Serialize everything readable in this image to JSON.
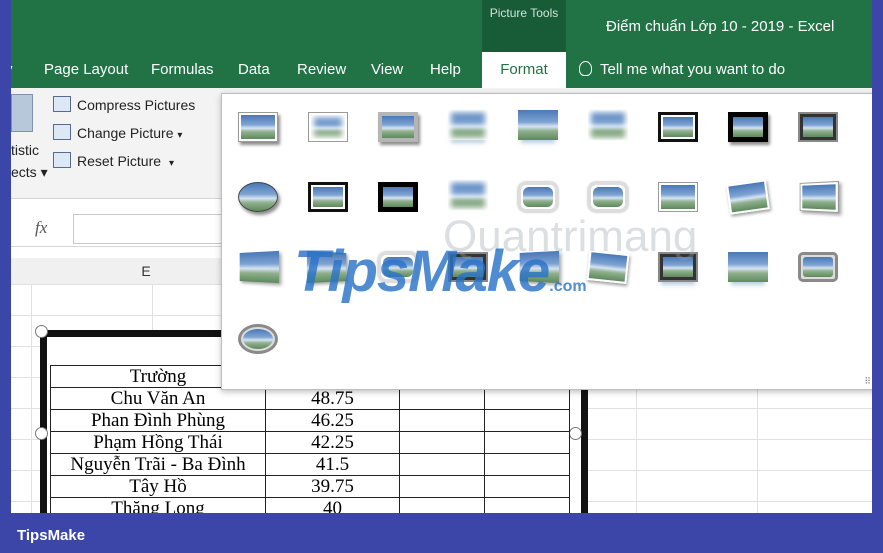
{
  "window": {
    "contextual_tab_group": "Picture Tools",
    "document_title": "Điểm chuẩn Lớp 10 - 2019  -  Excel"
  },
  "ribbon_tabs": [
    "v",
    "Page Layout",
    "Formulas",
    "Data",
    "Review",
    "View",
    "Help",
    "Format"
  ],
  "tell_me": "Tell me what you want to do",
  "adjust_group": {
    "left_partial_1": "tistic",
    "left_partial_2": "ects",
    "compress": "Compress Pictures",
    "change": "Change Picture",
    "reset": "Reset Picture"
  },
  "formula_bar": {
    "fx": "fx",
    "value": ""
  },
  "column_header": "E",
  "picture_table": {
    "header": "Trường",
    "rows": [
      {
        "school": "Chu Văn An",
        "score": "48.75"
      },
      {
        "school": "Phan Đình Phùng",
        "score": "46.25"
      },
      {
        "school": "Phạm Hồng Thái",
        "score": "42.25"
      },
      {
        "school": "Nguyễn Trãi - Ba Đình",
        "score": "41.5"
      },
      {
        "school": "Tây Hồ",
        "score": "39.75"
      },
      {
        "school": "Thăng Long",
        "score": "40"
      }
    ]
  },
  "picture_styles": [
    "simple-frame-white",
    "soft-edge-rectangle",
    "simple-frame-gray",
    "reflected-soft-edge",
    "soft-edge-reflection",
    "soft-edge",
    "double-frame-black",
    "thick-matte-black",
    "bevel-rectangle",
    "oval-shadow",
    "metal-frame",
    "thick-black",
    "soft-top",
    "rounded-reflection",
    "rounded-white",
    "rounded-shadow",
    "rotated-white",
    "perspective-shadow",
    "perspective-left",
    "reflected-perspective",
    "reflected-bevel",
    "bevel-rounded",
    "rotated-white-2",
    "bevel-perspective",
    "reflected-rounded",
    "metal-rounded",
    "metal-oval"
  ],
  "watermark": {
    "brand": "TipsMake",
    "suffix": ".com",
    "secondary": "Quantrimang"
  },
  "footer": {
    "brand": "TipsMake"
  }
}
